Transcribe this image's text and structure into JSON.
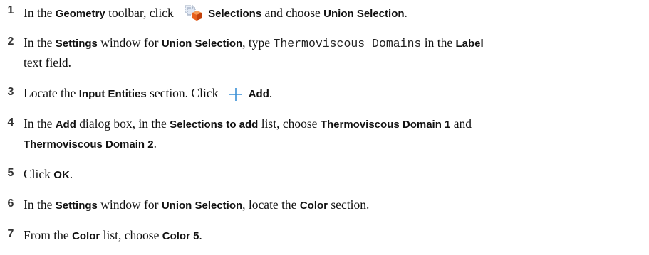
{
  "steps": [
    {
      "num": "1",
      "a": "In the ",
      "b": "Geometry",
      "c": " toolbar, click ",
      "d": "Selections",
      "e": " and choose ",
      "f": "Union Selection",
      "g": ".",
      "icon": "selections-icon"
    },
    {
      "num": "2",
      "a": "In the ",
      "b": "Settings",
      "c": " window for ",
      "d": "Union Selection",
      "e": ", type ",
      "f": "Thermoviscous Domains",
      "g": " in the ",
      "h": "Label",
      "line2": "text field."
    },
    {
      "num": "3",
      "a": "Locate the ",
      "b": "Input Entities",
      "c": " section. Click ",
      "d": "Add",
      "e": ".",
      "icon": "plus-icon"
    },
    {
      "num": "4",
      "a": "In the ",
      "b": "Add",
      "c": " dialog box, in the ",
      "d": "Selections to add",
      "e": " list, choose ",
      "f": "Thermoviscous Domain 1",
      "g": " and",
      "line2_bold": "Thermoviscous Domain 2",
      "line2_end": "."
    },
    {
      "num": "5",
      "a": "Click ",
      "b": "OK",
      "c": "."
    },
    {
      "num": "6",
      "a": "In the ",
      "b": "Settings",
      "c": " window for ",
      "d": "Union Selection",
      "e": ", locate the ",
      "f": "Color",
      "g": " section."
    },
    {
      "num": "7",
      "a": "From the ",
      "b": "Color",
      "c": " list, choose ",
      "d": "Color 5",
      "e": "."
    }
  ]
}
